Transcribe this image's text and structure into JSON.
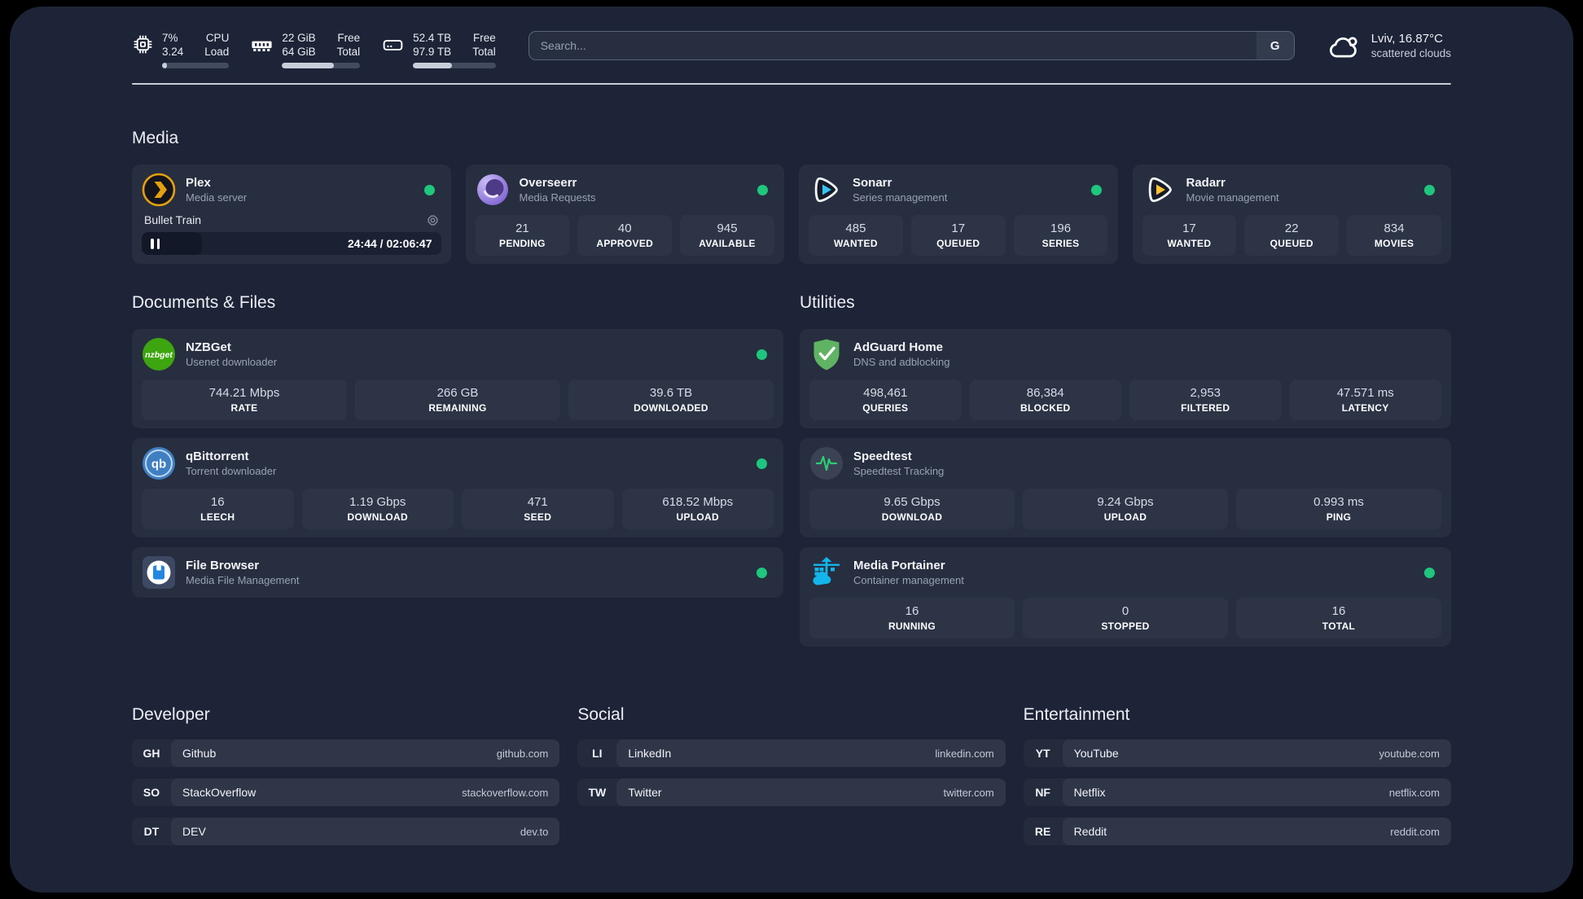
{
  "header": {
    "stats": [
      {
        "values": [
          "7%",
          "3.24"
        ],
        "labels": [
          "CPU",
          "Load"
        ],
        "progress": 7
      },
      {
        "values": [
          "22 GiB",
          "64 GiB"
        ],
        "labels": [
          "Free",
          "Total"
        ],
        "progress": 66
      },
      {
        "values": [
          "52.4 TB",
          "97.9 TB"
        ],
        "labels": [
          "Free",
          "Total"
        ],
        "progress": 47
      }
    ],
    "search": {
      "placeholder": "Search...",
      "button": "G"
    },
    "weather": {
      "location": "Lviv, 16.87°C",
      "condition": "scattered clouds"
    }
  },
  "colors": {
    "status_online": "#1ec77d",
    "plex_amber": "#e5a00d",
    "sonarr_blue": "#35c5f4",
    "radarr_orange": "#ffc230",
    "adguard_green": "#5fb363",
    "portainer_blue": "#13b5ea",
    "speedtest_pulse": "#2ecc71"
  },
  "sections": {
    "media": {
      "title": "Media",
      "cards": {
        "plex": {
          "name": "Plex",
          "desc": "Media server",
          "online": true,
          "player": {
            "title": "Bullet Train",
            "time": "24:44 / 02:06:47",
            "progress_pct": 20
          }
        },
        "overseerr": {
          "name": "Overseerr",
          "desc": "Media Requests",
          "online": true,
          "stats": [
            {
              "value": "21",
              "label": "PENDING"
            },
            {
              "value": "40",
              "label": "APPROVED"
            },
            {
              "value": "945",
              "label": "AVAILABLE"
            }
          ]
        },
        "sonarr": {
          "name": "Sonarr",
          "desc": "Series management",
          "online": true,
          "stats": [
            {
              "value": "485",
              "label": "WANTED"
            },
            {
              "value": "17",
              "label": "QUEUED"
            },
            {
              "value": "196",
              "label": "SERIES"
            }
          ]
        },
        "radarr": {
          "name": "Radarr",
          "desc": "Movie management",
          "online": true,
          "stats": [
            {
              "value": "17",
              "label": "WANTED"
            },
            {
              "value": "22",
              "label": "QUEUED"
            },
            {
              "value": "834",
              "label": "MOVIES"
            }
          ]
        }
      }
    },
    "documents": {
      "title": "Documents & Files",
      "cards": {
        "nzbget": {
          "name": "NZBGet",
          "desc": "Usenet downloader",
          "online": true,
          "stats": [
            {
              "value": "744.21 Mbps",
              "label": "RATE"
            },
            {
              "value": "266 GB",
              "label": "REMAINING"
            },
            {
              "value": "39.6 TB",
              "label": "DOWNLOADED"
            }
          ]
        },
        "qbittorrent": {
          "name": "qBittorrent",
          "desc": "Torrent downloader",
          "online": true,
          "stats": [
            {
              "value": "16",
              "label": "LEECH"
            },
            {
              "value": "1.19 Gbps",
              "label": "DOWNLOAD"
            },
            {
              "value": "471",
              "label": "SEED"
            },
            {
              "value": "618.52 Mbps",
              "label": "UPLOAD"
            }
          ]
        },
        "filebrowser": {
          "name": "File Browser",
          "desc": "Media File Management",
          "online": true
        }
      }
    },
    "utilities": {
      "title": "Utilities",
      "cards": {
        "adguard": {
          "name": "AdGuard Home",
          "desc": "DNS and adblocking",
          "stats": [
            {
              "value": "498,461",
              "label": "QUERIES"
            },
            {
              "value": "86,384",
              "label": "BLOCKED"
            },
            {
              "value": "2,953",
              "label": "FILTERED"
            },
            {
              "value": "47.571 ms",
              "label": "LATENCY"
            }
          ]
        },
        "speedtest": {
          "name": "Speedtest",
          "desc": "Speedtest Tracking",
          "stats": [
            {
              "value": "9.65 Gbps",
              "label": "DOWNLOAD"
            },
            {
              "value": "9.24 Gbps",
              "label": "UPLOAD"
            },
            {
              "value": "0.993 ms",
              "label": "PING"
            }
          ]
        },
        "portainer": {
          "name": "Media Portainer",
          "desc": "Container management",
          "online": true,
          "stats": [
            {
              "value": "16",
              "label": "RUNNING"
            },
            {
              "value": "0",
              "label": "STOPPED"
            },
            {
              "value": "16",
              "label": "TOTAL"
            }
          ]
        }
      }
    }
  },
  "bookmarks": [
    {
      "title": "Developer",
      "items": [
        {
          "abbr": "GH",
          "name": "Github",
          "url": "github.com"
        },
        {
          "abbr": "SO",
          "name": "StackOverflow",
          "url": "stackoverflow.com"
        },
        {
          "abbr": "DT",
          "name": "DEV",
          "url": "dev.to"
        }
      ]
    },
    {
      "title": "Social",
      "items": [
        {
          "abbr": "LI",
          "name": "LinkedIn",
          "url": "linkedin.com"
        },
        {
          "abbr": "TW",
          "name": "Twitter",
          "url": "twitter.com"
        }
      ]
    },
    {
      "title": "Entertainment",
      "items": [
        {
          "abbr": "YT",
          "name": "YouTube",
          "url": "youtube.com"
        },
        {
          "abbr": "NF",
          "name": "Netflix",
          "url": "netflix.com"
        },
        {
          "abbr": "RE",
          "name": "Reddit",
          "url": "reddit.com"
        }
      ]
    }
  ]
}
